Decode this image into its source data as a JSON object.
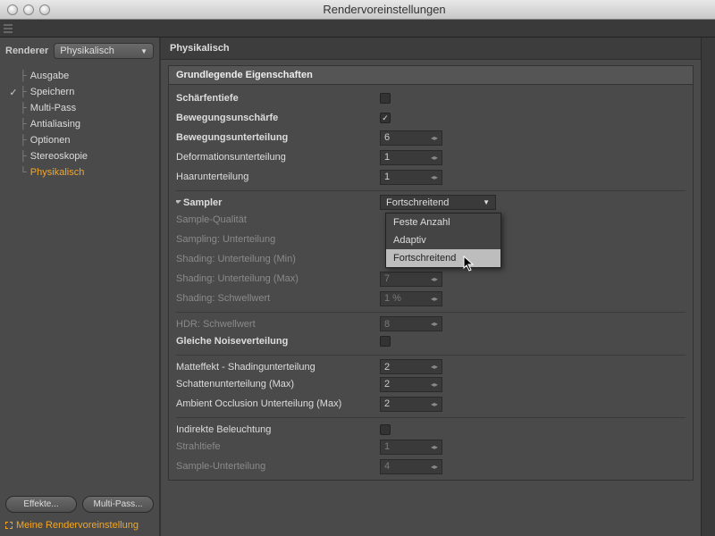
{
  "window": {
    "title": "Rendervoreinstellungen"
  },
  "sidebar": {
    "renderer_label": "Renderer",
    "renderer_value": "Physikalisch",
    "items": [
      {
        "label": "Ausgabe",
        "checked": ""
      },
      {
        "label": "Speichern",
        "checked": "✓"
      },
      {
        "label": "Multi-Pass",
        "checked": " "
      },
      {
        "label": "Antialiasing",
        "checked": ""
      },
      {
        "label": "Optionen",
        "checked": ""
      },
      {
        "label": "Stereoskopie",
        "checked": ""
      },
      {
        "label": "Physikalisch",
        "checked": ""
      }
    ],
    "effects_btn": "Effekte...",
    "multipass_btn": "Multi-Pass...",
    "preset": "Meine Rendervoreinstellung"
  },
  "main": {
    "title": "Physikalisch",
    "section": "Grundlegende Eigenschaften",
    "rows": {
      "schaerfentiefe": "Schärfentiefe",
      "bewegung": "Bewegungsunschärfe",
      "bewegung_unt": "Bewegungsunterteilung",
      "bewegung_unt_v": "6",
      "deform": "Deformationsunterteilung",
      "deform_v": "1",
      "haar": "Haarunterteilung",
      "haar_v": "1",
      "sampler": "Sampler",
      "sampler_v": "Fortschreitend",
      "sample_q": "Sample-Qualität",
      "sampling_unt": "Sampling: Unterteilung",
      "shading_min": "Shading: Unterteilung (Min)",
      "shading_min_v": "",
      "shading_max": "Shading: Unterteilung (Max)",
      "shading_max_v": "7",
      "shading_thr": "Shading: Schwellwert",
      "shading_thr_v": "1 %",
      "hdr": "HDR: Schwellwert",
      "hdr_v": "8",
      "noise": "Gleiche Noiseverteilung",
      "matte": "Matteffekt - Shadingunterteilung",
      "matte_v": "2",
      "schatten": "Schattenunterteilung (Max)",
      "schatten_v": "2",
      "ao": "Ambient Occlusion Unterteilung (Max)",
      "ao_v": "2",
      "indirekt": "Indirekte Beleuchtung",
      "strahl": "Strahltiefe",
      "strahl_v": "1",
      "sample_unt": "Sample-Unterteilung",
      "sample_unt_v": "4"
    },
    "dropdown": {
      "opt1": "Feste Anzahl",
      "opt2": "Adaptiv",
      "opt3": "Fortschreitend"
    }
  }
}
